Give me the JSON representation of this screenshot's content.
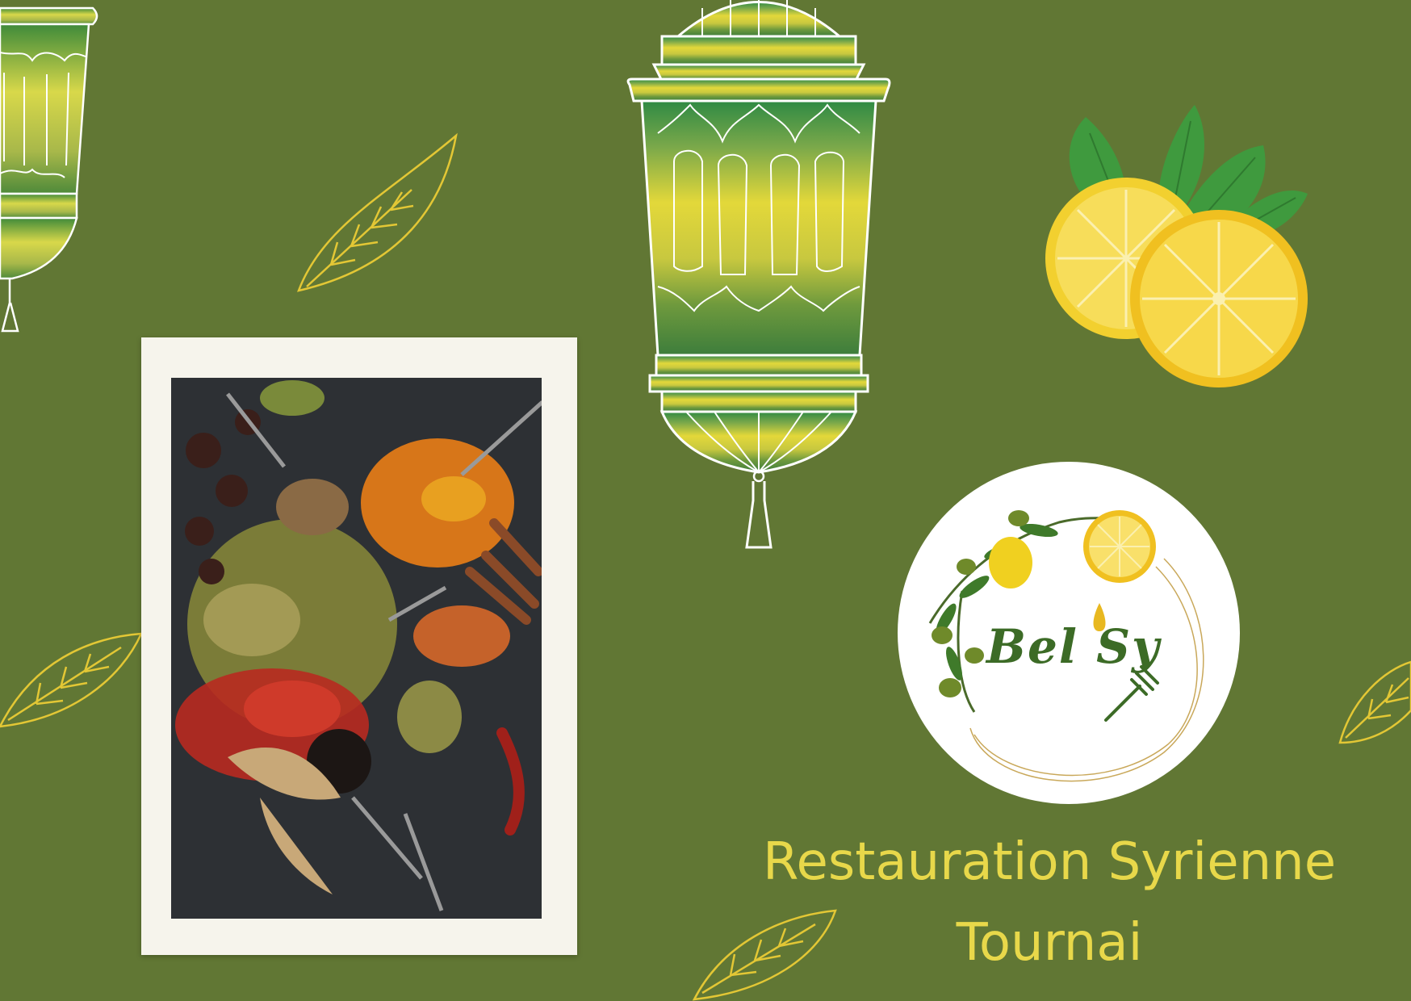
{
  "brand": {
    "logo_text": "Bel Sy"
  },
  "tagline": {
    "line1": "Restauration Syrienne",
    "line2": "Tournai"
  },
  "colors": {
    "background": "#617734",
    "accent_yellow": "#e8d84a",
    "lantern_outline": "#ffffff",
    "leaf_outline": "#e3c735"
  },
  "decorations": [
    "lantern",
    "leaf-outline",
    "lemon-slice",
    "mint-leaf",
    "spices-photo"
  ]
}
